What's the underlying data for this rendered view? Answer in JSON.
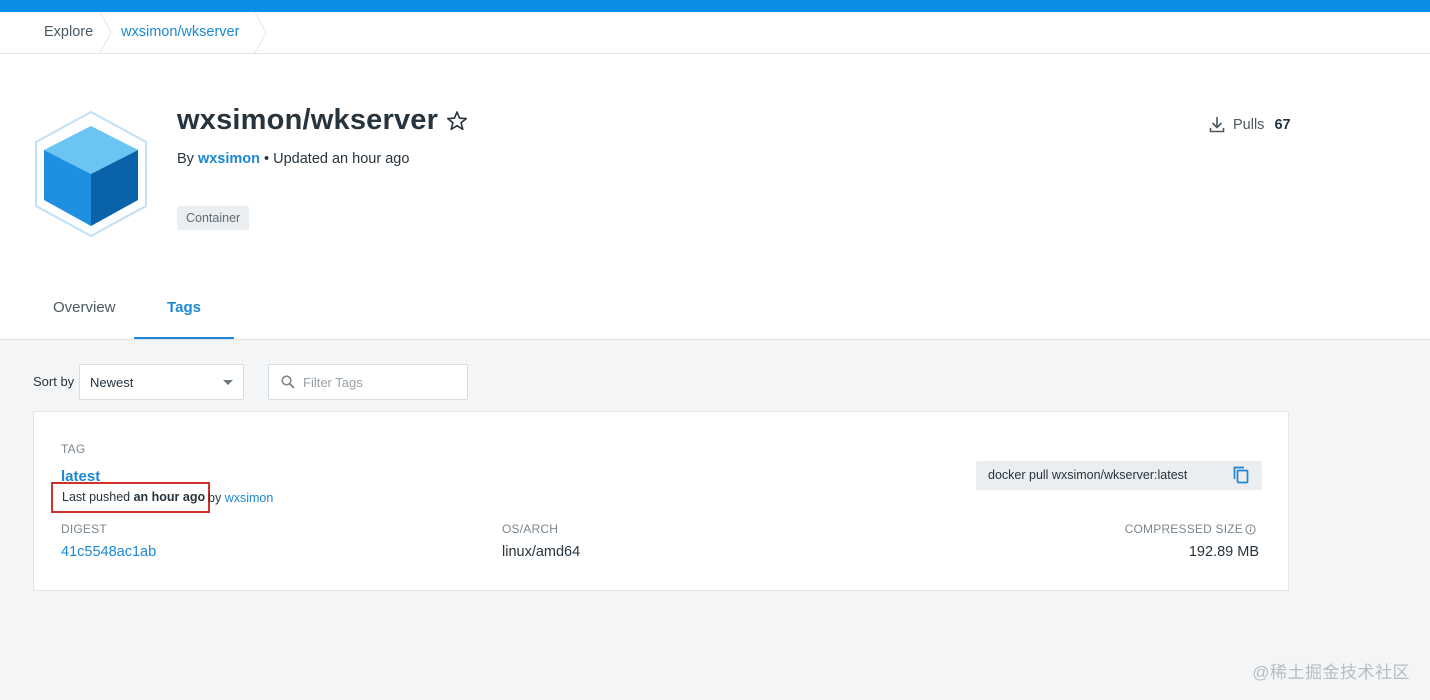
{
  "breadcrumb": {
    "explore": "Explore",
    "repo": "wxsimon/wkserver"
  },
  "repo": {
    "title": "wxsimon/wkserver",
    "by_prefix": "By ",
    "author": "wxsimon",
    "updated": " • Updated an hour ago",
    "badge": "Container",
    "pulls_label": "Pulls",
    "pulls_count": "67"
  },
  "tabs": {
    "overview": "Overview",
    "tags": "Tags"
  },
  "controls": {
    "sort_label": "Sort by",
    "sort_value": "Newest",
    "filter_placeholder": "Filter Tags"
  },
  "tag": {
    "header": "TAG",
    "name": "latest",
    "pushed_prefix": "Last pushed ",
    "pushed_time": "an hour ago",
    "by_prefix": "by ",
    "by_user": "wxsimon",
    "pull_command": "docker pull wxsimon/wkserver:latest",
    "digest_label": "DIGEST",
    "digest": "41c5548ac1ab",
    "osarch_label": "OS/ARCH",
    "osarch": "linux/amd64",
    "size_label": "COMPRESSED SIZE",
    "size": "192.89 MB"
  },
  "watermark": "@稀土掘金技术社区",
  "colors": {
    "accent": "#1d87d3",
    "topbar": "#0b8ee6",
    "highlight": "#d0312d"
  }
}
